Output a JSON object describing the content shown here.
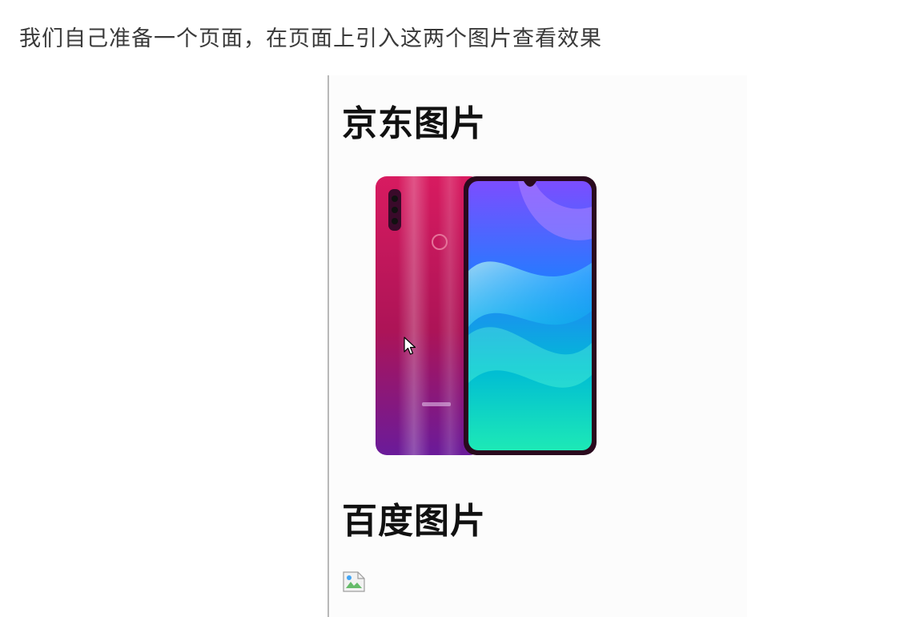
{
  "caption": "我们自己准备一个页面，在页面上引入这两个图片查看效果",
  "page": {
    "jd_heading": "京东图片",
    "baidu_heading": "百度图片"
  },
  "images": {
    "jd_image": "phone-product-image",
    "baidu_image": "broken-image-icon"
  },
  "colors": {
    "phone_back_top": "#c2185b",
    "phone_back_bottom": "#6a1b9a",
    "screen_top": "#7c4dff",
    "screen_mid": "#2196f3",
    "screen_bottom": "#1de9b6"
  }
}
